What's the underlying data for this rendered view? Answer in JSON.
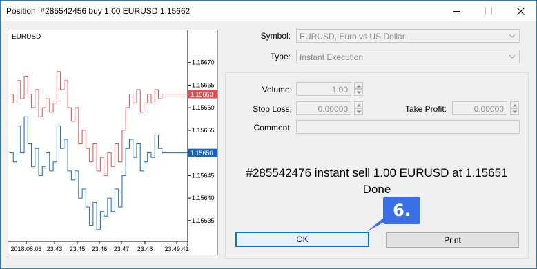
{
  "window": {
    "title": "Position: #285542456 buy 1.00 EURUSD 1.15662"
  },
  "chart": {
    "symbol": "EURUSD",
    "y_ticks": [
      "1.15670",
      "1.15665",
      "1.15660",
      "1.15655",
      "1.15645",
      "1.15640",
      "1.15635"
    ],
    "x_ticks": [
      "2018.08.03",
      "23:43",
      "23:45",
      "23:46",
      "23:47",
      "23:48",
      "23:49:41"
    ],
    "ask_label": "1.15663",
    "bid_label": "1.15650",
    "colors": {
      "ask": "#e05050",
      "bid": "#1565c0"
    }
  },
  "chart_data": {
    "type": "line",
    "series": [
      {
        "values": [
          1.15663,
          1.15661,
          1.15666,
          1.15662,
          1.15667,
          1.15663,
          1.1566,
          1.15664,
          1.15658,
          1.1566,
          1.15662,
          1.15659,
          1.15661,
          1.15668,
          1.15664,
          1.15666,
          1.1566,
          1.15657,
          1.1566,
          1.15652,
          1.15655,
          1.15651,
          1.15648,
          1.15652,
          1.15646,
          1.15649,
          1.15645,
          1.1565,
          1.15647,
          1.15652,
          1.15648,
          1.15655,
          1.1566,
          1.15663,
          1.15661,
          1.15664,
          1.15659,
          1.15661,
          1.15663,
          1.15661,
          1.15664,
          1.15662,
          1.15663,
          1.15663
        ]
      },
      {
        "values": [
          1.1565,
          1.15648,
          1.15656,
          1.1565,
          1.15658,
          1.15652,
          1.15647,
          1.15651,
          1.15645,
          1.15647,
          1.1565,
          1.15646,
          1.15648,
          1.15656,
          1.15651,
          1.15653,
          1.15646,
          1.15644,
          1.15646,
          1.1564,
          1.15642,
          1.15638,
          1.15634,
          1.15639,
          1.15633,
          1.15637,
          1.15636,
          1.1564,
          1.15637,
          1.15642,
          1.15638,
          1.15645,
          1.15651,
          1.15653,
          1.15649,
          1.15652,
          1.15646,
          1.15648,
          1.1565,
          1.15649,
          1.15654,
          1.15651,
          1.1565,
          1.1565
        ]
      }
    ],
    "ylim": [
      1.15631,
      1.15675
    ]
  },
  "form": {
    "symbol_label": "Symbol:",
    "symbol_value": "EURUSD, Euro vs US Dollar",
    "type_label": "Type:",
    "type_value": "Instant Execution",
    "volume_label": "Volume:",
    "volume_value": "1.00",
    "stop_loss_label": "Stop Loss:",
    "stop_loss_value": "0.00000",
    "take_profit_label": "Take Profit:",
    "take_profit_value": "0.00000",
    "comment_label": "Comment:",
    "comment_value": ""
  },
  "result": {
    "line1": "#285542476 instant sell 1.00 EURUSD at 1.15651",
    "line2": "Done"
  },
  "buttons": {
    "ok": "OK",
    "print": "Print"
  },
  "callout": {
    "text": "6."
  }
}
